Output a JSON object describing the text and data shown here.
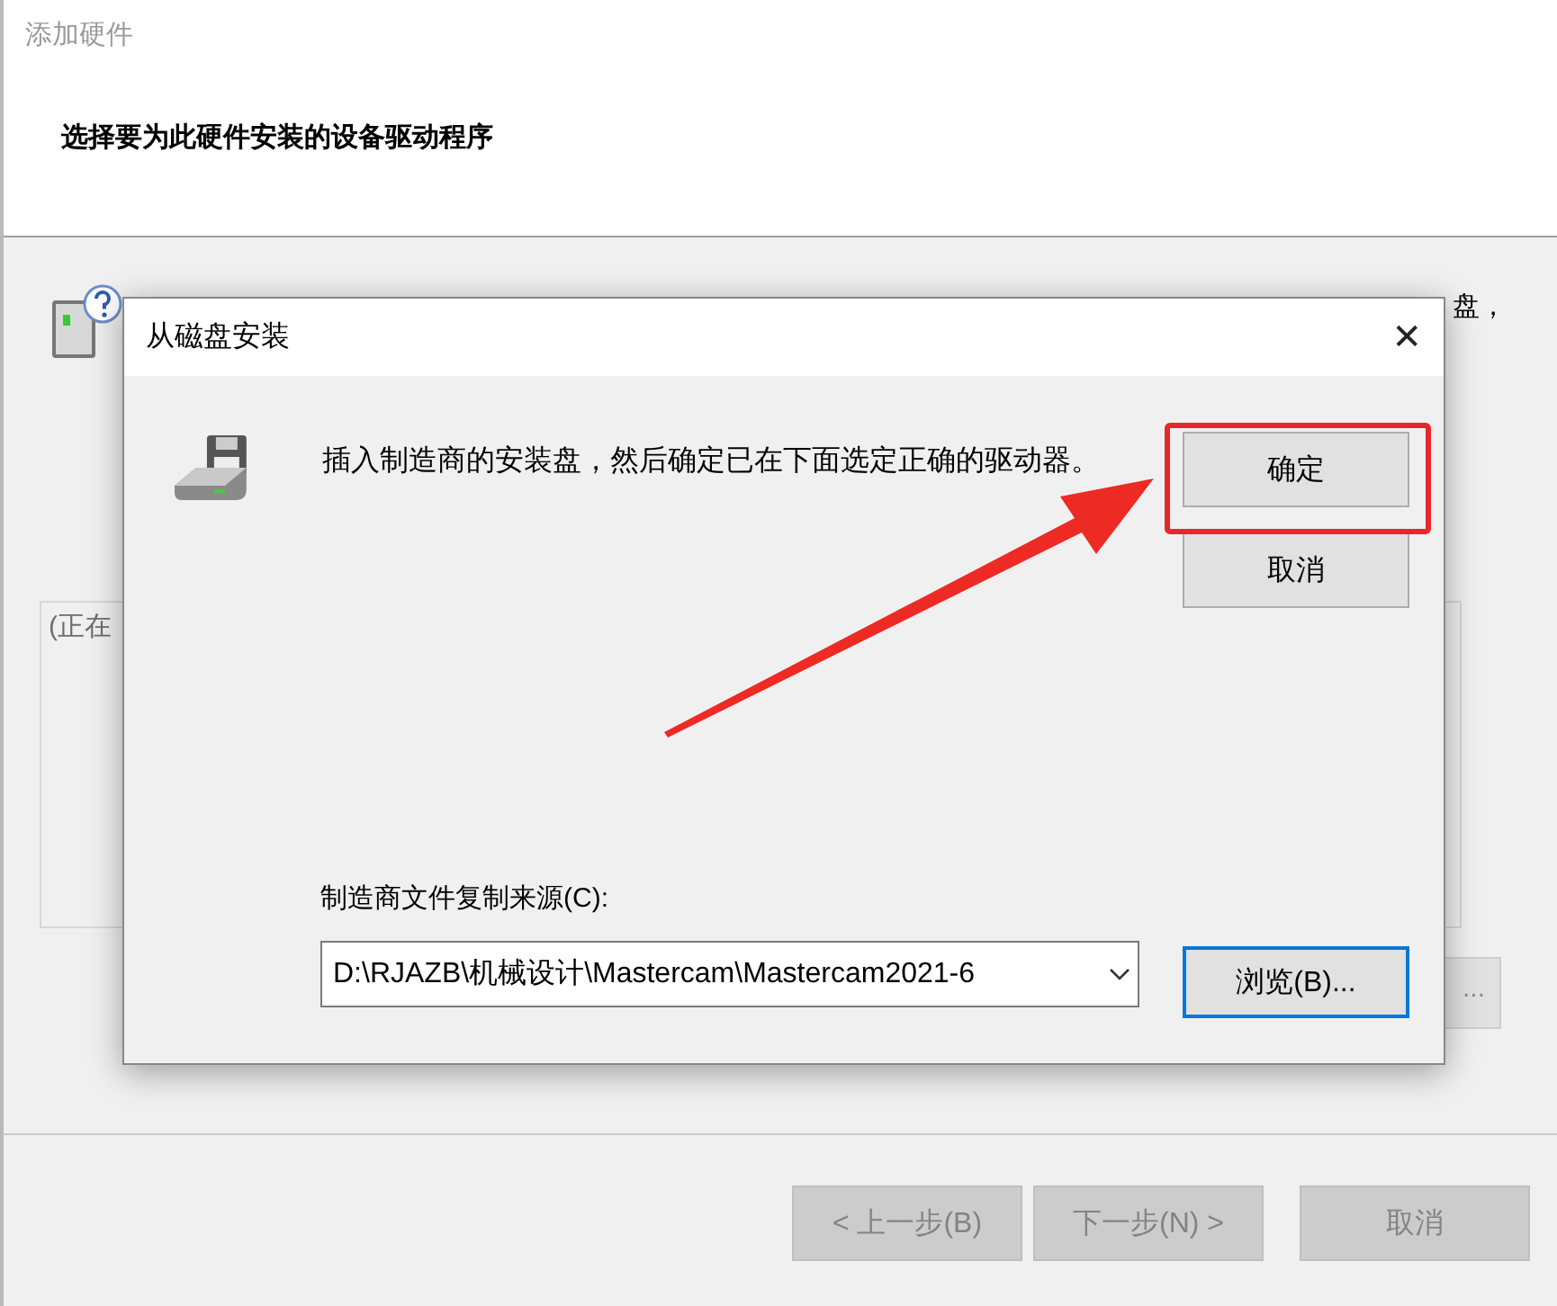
{
  "wizard": {
    "title": "添加硬件",
    "heading": "选择要为此硬件安装的设备驱动程序",
    "instruction_fragment": "盘，",
    "list_fragment": "(正在",
    "hidden_button_fragment": "...",
    "buttons": [
      {
        "label": "< 上一步(B)",
        "disabled": true
      },
      {
        "label": "下一步(N) >",
        "disabled": true
      },
      {
        "label": "取消",
        "disabled": true
      }
    ]
  },
  "dialog": {
    "title": "从磁盘安装",
    "close": "✕",
    "message": "插入制造商的安装盘，然后确定已在下面选定正确的驱动器。",
    "source_label": "制造商文件复制来源(C):",
    "source_value": "D:\\RJAZB\\机械设计\\Mastercam\\Mastercam2021-6",
    "buttons": [
      {
        "label": "确定",
        "focused": false,
        "annotated": true
      },
      {
        "label": "取消",
        "focused": false,
        "annotated": false
      }
    ],
    "browse": {
      "label": "浏览(B)...",
      "focused": true
    }
  }
}
